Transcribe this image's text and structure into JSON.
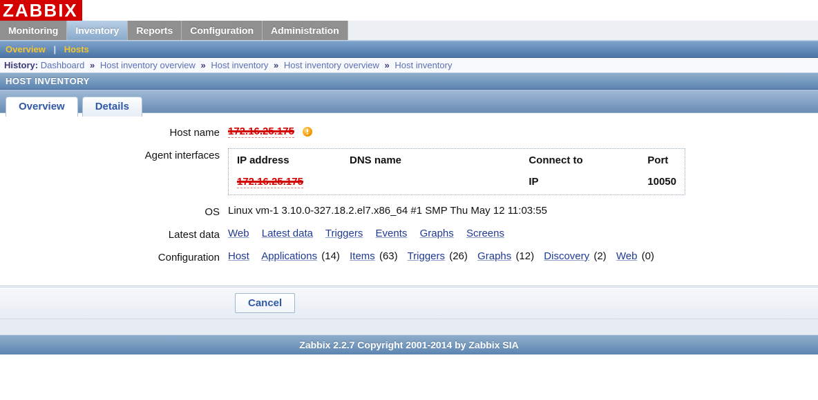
{
  "brand": "ZABBIX",
  "main_menu": {
    "items": [
      {
        "label": "Monitoring",
        "active": false
      },
      {
        "label": "Inventory",
        "active": true
      },
      {
        "label": "Reports",
        "active": false
      },
      {
        "label": "Configuration",
        "active": false
      },
      {
        "label": "Administration",
        "active": false
      }
    ]
  },
  "sub_menu": {
    "items": [
      {
        "label": "Overview"
      },
      {
        "label": "Hosts"
      }
    ],
    "separator": "|"
  },
  "history": {
    "label": "History:",
    "crumbs": [
      "Dashboard",
      "Host inventory overview",
      "Host inventory",
      "Host inventory overview",
      "Host inventory"
    ],
    "arrow": "»"
  },
  "page_header": "HOST INVENTORY",
  "tabs": {
    "items": [
      {
        "label": "Overview",
        "active": true
      },
      {
        "label": "Details",
        "active": false
      }
    ]
  },
  "host": {
    "labels": {
      "host_name": "Host name",
      "agent_interfaces": "Agent interfaces",
      "os": "OS",
      "latest_data": "Latest data",
      "configuration": "Configuration"
    },
    "host_name": "172.16.25.175",
    "status_icon_name": "warning-icon",
    "interfaces": {
      "headers": {
        "ip": "IP address",
        "dns": "DNS name",
        "connect_to": "Connect to",
        "port": "Port"
      },
      "rows": [
        {
          "ip": "172.16.25.175",
          "dns": "",
          "connect_to": "IP",
          "port": "10050"
        }
      ]
    },
    "os": "Linux vm-1 3.10.0-327.18.2.el7.x86_64 #1 SMP Thu May 12 11:03:55",
    "latest_data_links": [
      {
        "label": "Web"
      },
      {
        "label": "Latest data"
      },
      {
        "label": "Triggers"
      },
      {
        "label": "Events"
      },
      {
        "label": "Graphs"
      },
      {
        "label": "Screens"
      }
    ],
    "configuration_links": [
      {
        "label": "Host"
      },
      {
        "label": "Applications",
        "count": "(14)"
      },
      {
        "label": "Items",
        "count": "(63)"
      },
      {
        "label": "Triggers",
        "count": "(26)"
      },
      {
        "label": "Graphs",
        "count": "(12)"
      },
      {
        "label": "Discovery",
        "count": "(2)"
      },
      {
        "label": "Web",
        "count": "(0)"
      }
    ]
  },
  "buttons": {
    "cancel": "Cancel"
  },
  "footer": "Zabbix 2.2.7 Copyright 2001-2014 by Zabbix SIA"
}
